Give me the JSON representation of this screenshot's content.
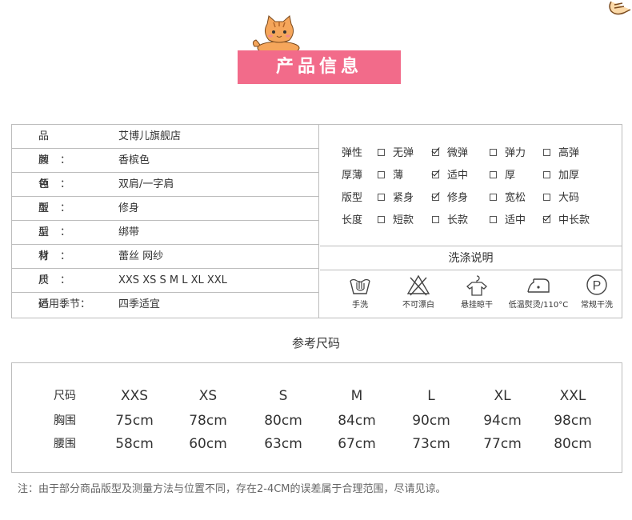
{
  "header": {
    "title": "产品信息"
  },
  "info": [
    {
      "label": "品牌：",
      "value": "艾博儿旗舰店"
    },
    {
      "label": "颜色：",
      "value": "香槟色"
    },
    {
      "label": "领型：",
      "value": "双肩/一字肩"
    },
    {
      "label": "版型：",
      "value": "修身"
    },
    {
      "label": "后背：",
      "value": "绑带"
    },
    {
      "label": "材质：",
      "value": "蕾丝 网纱"
    },
    {
      "label": "尺码：",
      "value": "XXS XS S M L XL XXL"
    },
    {
      "label": "适用季节：",
      "value": "四季适宜"
    }
  ],
  "attributes": [
    {
      "label": "弹性",
      "options": [
        {
          "text": "无弹",
          "checked": false
        },
        {
          "text": "微弹",
          "checked": true
        },
        {
          "text": "弹力",
          "checked": false
        },
        {
          "text": "高弹",
          "checked": false
        }
      ]
    },
    {
      "label": "厚薄",
      "options": [
        {
          "text": "薄",
          "checked": false
        },
        {
          "text": "适中",
          "checked": true
        },
        {
          "text": "厚",
          "checked": false
        },
        {
          "text": "加厚",
          "checked": false
        }
      ]
    },
    {
      "label": "版型",
      "options": [
        {
          "text": "紧身",
          "checked": false
        },
        {
          "text": "修身",
          "checked": true
        },
        {
          "text": "宽松",
          "checked": false
        },
        {
          "text": "大码",
          "checked": false
        }
      ]
    },
    {
      "label": "长度",
      "options": [
        {
          "text": "短款",
          "checked": false
        },
        {
          "text": "长款",
          "checked": false
        },
        {
          "text": "适中",
          "checked": false
        },
        {
          "text": "中长款",
          "checked": true
        }
      ]
    }
  ],
  "wash": {
    "title": "洗涤说明",
    "icons": [
      {
        "icon": "hand-wash-icon",
        "label": "手洗"
      },
      {
        "icon": "no-bleach-icon",
        "label": "不可漂白"
      },
      {
        "icon": "hang-dry-icon",
        "label": "悬挂晾干"
      },
      {
        "icon": "low-iron-icon",
        "label": "低温熨烫/110°C"
      },
      {
        "icon": "dry-clean-icon",
        "label": "常规干洗",
        "symbol": "P"
      }
    ]
  },
  "size_chart": {
    "title": "参考尺码",
    "header_label": "尺码",
    "sizes": [
      "XXS",
      "XS",
      "S",
      "M",
      "L",
      "XL",
      "XXL"
    ],
    "rows": [
      {
        "label": "胸围",
        "values": [
          "75cm",
          "78cm",
          "80cm",
          "84cm",
          "90cm",
          "94cm",
          "98cm"
        ]
      },
      {
        "label": "腰围",
        "values": [
          "58cm",
          "60cm",
          "63cm",
          "67cm",
          "73cm",
          "77cm",
          "80cm"
        ]
      }
    ]
  },
  "note": "注：由于部分商品版型及测量方法与位置不同，存在2-4CM的误差属于合理范围，尽请见谅。",
  "colors": {
    "banner": "#f26b8a",
    "border": "#bdbdbd",
    "cat": "#f5a65b"
  }
}
